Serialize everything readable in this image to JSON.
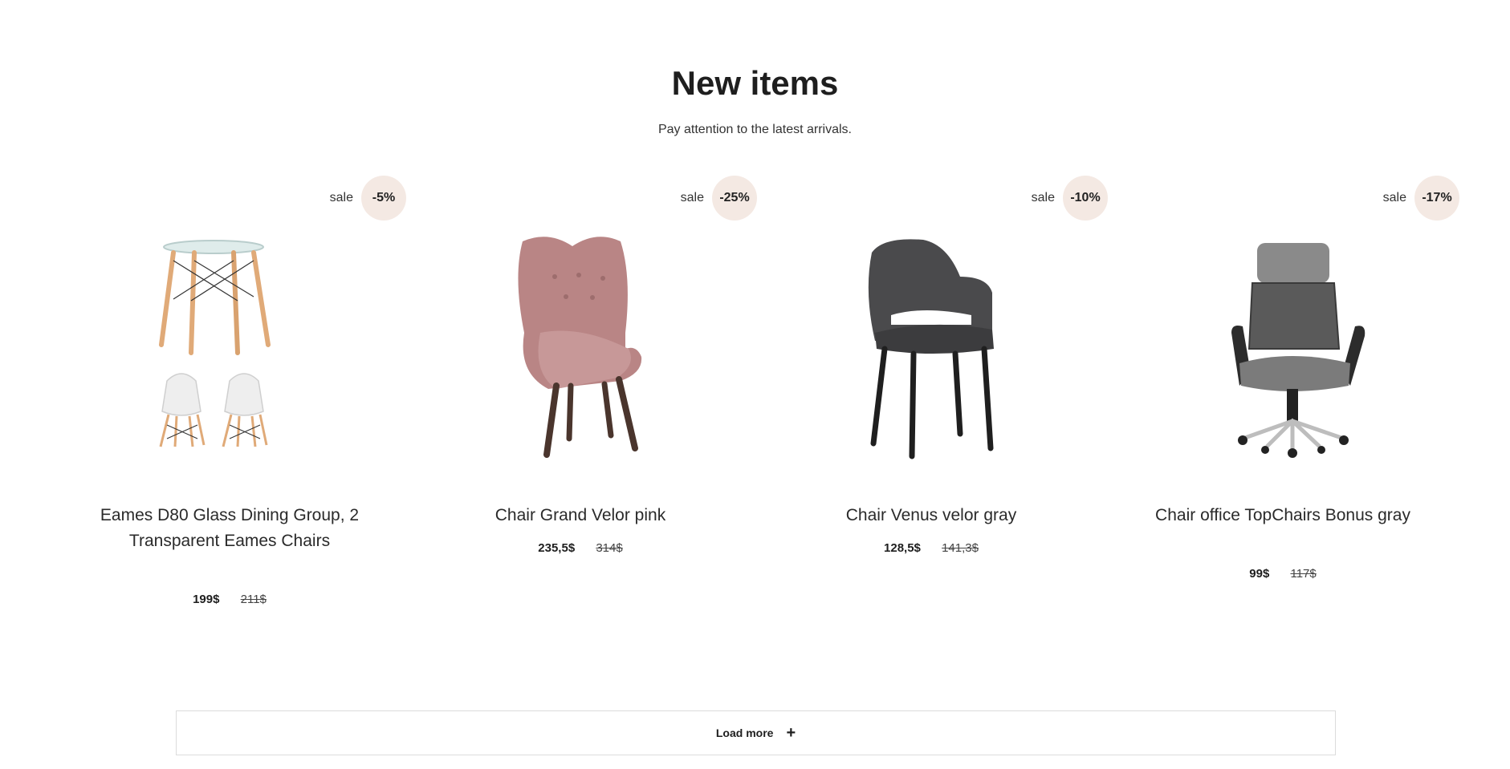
{
  "section": {
    "title": "New items",
    "subtitle": "Pay attention to the latest arrivals."
  },
  "products": [
    {
      "sale_word": "sale",
      "discount": "-5%",
      "name": "Eames D80 Glass Dining Group, 2 Transparent Eames Chairs",
      "price": "199$",
      "old_price": "211$",
      "image_icon": "table-chairs-set-image"
    },
    {
      "sale_word": "sale",
      "discount": "-25%",
      "name": "Chair Grand Velor pink",
      "price": "235,5$",
      "old_price": "314$",
      "image_icon": "pink-armchair-image"
    },
    {
      "sale_word": "sale",
      "discount": "-10%",
      "name": "Chair Venus velor gray",
      "price": "128,5$",
      "old_price": "141,3$",
      "image_icon": "gray-chair-image"
    },
    {
      "sale_word": "sale",
      "discount": "-17%",
      "name": "Chair office TopChairs Bonus gray",
      "price": "99$",
      "old_price": "117$",
      "image_icon": "office-chair-image"
    }
  ],
  "load_more": {
    "label": "Load more",
    "icon": "plus-icon"
  },
  "colors": {
    "sale_badge_bg": "#f4e9e3",
    "text": "#1e1e1e"
  }
}
